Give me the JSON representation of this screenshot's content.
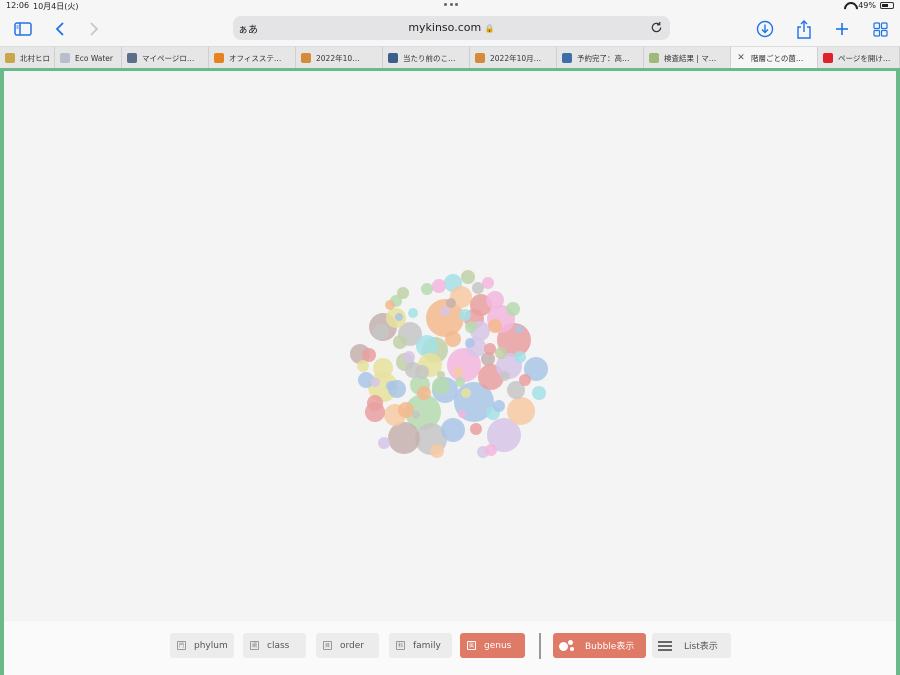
{
  "status": {
    "time": "12:06",
    "date": "10月4日(火)",
    "battery": "49%",
    "battery_level": 0.49
  },
  "toolbar": {
    "aa": "ぁあ",
    "url": "mykinso.com"
  },
  "tabs": [
    {
      "title": "北村ヒロ",
      "favicon_color": "#c8a64a",
      "favicon": "globe-icon"
    },
    {
      "title": "Eco Water",
      "favicon_color": "#b9bfca",
      "favicon": "generic-page-icon"
    },
    {
      "title": "マイページロ…",
      "favicon_color": "#5c6f89",
      "favicon": "question-icon"
    },
    {
      "title": "オフィスステ…",
      "favicon_color": "#e8821e",
      "favicon": "orange-square-icon"
    },
    {
      "title": "2022年10…",
      "favicon_color": "#d48c3a",
      "favicon": "colorful-wheel-icon"
    },
    {
      "title": "当たり前のこ…",
      "favicon_color": "#3b5e8a",
      "favicon": "script-icon"
    },
    {
      "title": "2022年10月…",
      "favicon_color": "#d48c3a",
      "favicon": "colorful-wheel-icon"
    },
    {
      "title": "予約完了：高…",
      "favicon_color": "#3f6fa8",
      "favicon": "ring-icon"
    },
    {
      "title": "検査結果 | マ…",
      "favicon_color": "#a0b87a",
      "favicon": "leaf-icon"
    },
    {
      "title": "階層ごとの菌…",
      "favicon_color": "#555555",
      "favicon": "close-icon",
      "active": true
    },
    {
      "title": "ページを開け…",
      "favicon_color": "#e0202a",
      "favicon": "yahoo-icon"
    }
  ],
  "controls": {
    "phylum": "phylum",
    "phylum_icon": "門",
    "class": "class",
    "class_icon": "綱",
    "order": "order",
    "order_icon": "目",
    "family": "family",
    "family_icon": "科",
    "genus": "genus",
    "genus_icon": "属",
    "bubble": "Bubble表示",
    "list": "List表示"
  },
  "colors": {
    "accent": "#1e73e8",
    "active_button": "#df7a66",
    "frame_green": "#69b98a"
  }
}
